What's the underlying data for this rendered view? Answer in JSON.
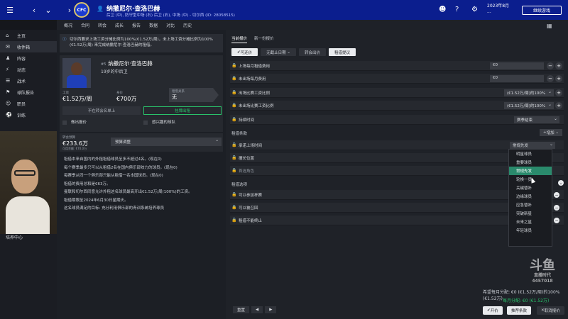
{
  "topbar": {
    "player_name": "纳撒尼尔·查洛巴赫",
    "player_info": "后卫 (中), 防守型中场 (右) 后卫 (右), 中场 (中) - 切尔西 (ID: 28058515)",
    "crest_text": "CFC",
    "date_line1": "2023年8月",
    "date_line2": "...",
    "continue_label": "继续游戏"
  },
  "menubar": [
    "概况",
    "合同",
    "转会",
    "成长",
    "报告",
    "数据",
    "对比",
    "历史"
  ],
  "sidebar": {
    "items": [
      {
        "icon": "⌂",
        "label": "主页"
      },
      {
        "icon": "✉",
        "label": "收件箱"
      },
      {
        "icon": "♟",
        "label": "阵容"
      },
      {
        "icon": "⚡",
        "label": "动态"
      },
      {
        "icon": "☰",
        "label": "战术"
      },
      {
        "icon": "⚑",
        "label": "球队报告"
      },
      {
        "icon": "☺",
        "label": "职员"
      },
      {
        "icon": "⚽",
        "label": "训练"
      }
    ],
    "bottom_label": "培养中心"
  },
  "left": {
    "notice": "切尔西要求上场工资分摊比例为100%(€1.52万/周)，未上场工资分摊比例为100%(€1.52万/周) 来完成纳撒尼尔·查洛巴赫的租借。",
    "name_prefix": "#5",
    "name": "纳撒尼尔·查洛巴赫",
    "position": "19岁的中后卫",
    "wage_label": "工资",
    "wage": "€1.52万/周",
    "value_label": "身价",
    "value": "€700万",
    "relation_label": "租借关系",
    "relation": "无",
    "btn_not_listed": "不在转会名单上",
    "btn_loan_listed": "挂牌出租",
    "cb_make_offer": "做出报价",
    "cb_interested": "感兴趣的球队",
    "budget_label": "转会预算",
    "budget": "€233.6万",
    "budget_sub": "可用余额: €70.0万",
    "budget_select": "预算调整",
    "bullets": [
      "租借本来自国内的外租租借球员至多不超过4名。(现在0)",
      "每个赛季最多只可以从租借2名在国内俱乐部效力的球员。(现在0)",
      "每赛季从同一个俱乐部只能从租借一名本国球员。(现在0)",
      "租借的费用总和是€63万。",
      "曼联和切尔西同意允许外租这名球员最高开出€1.52万/周(100%)的工资。",
      "租借期限至2024年6月30日星期天。",
      "这名球员满足的目标: 充分利用俱乐部的青训系统培养球员"
    ]
  },
  "right": {
    "tabs": [
      "当前报价",
      "新一份报价"
    ],
    "subtabs": [
      "可还价",
      "无截止日期",
      "转会出价",
      "租借提议"
    ],
    "rows": [
      {
        "label": "上场每月租借费用",
        "value": "€0"
      },
      {
        "label": "未出场每月费用",
        "value": "€0"
      },
      {
        "label": "出场比赛工资比例",
        "value": "(€1.52万/周)的100%"
      },
      {
        "label": "未出场比赛工资比例",
        "value": "(€1.52万/周)的100%"
      },
      {
        "label": "持续时间",
        "value": "赛季结束"
      }
    ],
    "section_terms": "租借条款",
    "add_label": "增加",
    "terms_rows": [
      {
        "label": "承诺上场时间",
        "value": "常规先发"
      },
      {
        "label": "擅长位置",
        "value": ""
      },
      {
        "label": "首选角色",
        "value": ""
      }
    ],
    "section_options": "租借选项",
    "option_rows": [
      {
        "label": "可以参加杯赛"
      },
      {
        "label": "可以被召回"
      },
      {
        "label": "租借不能终止"
      }
    ],
    "dropdown_options": [
      "明星球员",
      "重要球员",
      "常规先发",
      "轮换一员",
      "关键替补",
      "边缘球员",
      "应急替补",
      "突破新星",
      "未来之星",
      "年轻球员"
    ],
    "bottom_buttons": [
      "重置",
      "◀",
      "▶"
    ],
    "summary_top": "希望每月分配: €0 (€1.52万/周)的100% (€1.52万)",
    "summary_green": "每月分配: €0 (€1.52万)",
    "actions": [
      "开价",
      "推荐条款",
      "取消报价"
    ]
  },
  "watermark": {
    "logo": "斗鱼",
    "sub": "直播时代",
    "id": "4457018"
  },
  "colors": {
    "topbar": "#0b1e8e",
    "accent_green": "#29c26a",
    "highlight": "#2a8a6c"
  }
}
